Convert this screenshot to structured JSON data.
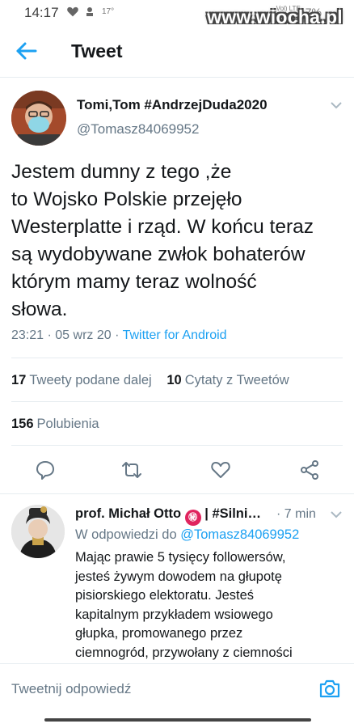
{
  "status_bar": {
    "time": "14:17",
    "temp": "17°",
    "net_top": "Vol) LTE",
    "net_bottom": "LTE1",
    "battery": "7%"
  },
  "watermark": "www.wiocha.pl",
  "header": {
    "back_icon": "arrow-left-icon",
    "title": "Tweet"
  },
  "tweet": {
    "author_name": "Tomi,Tom #AndrzejDuda2020",
    "author_handle": "@Tomasz84069952",
    "text": "Jestem dumny z tego ,że\nto Wojsko Polskie przejęło\nWesterplatte i rząd. W końcu teraz\nsą wydobywane zwłok bohaterów\nktórym mamy teraz wolność\nsłowa.",
    "time": "23:21",
    "date": "05 wrz 20",
    "separator": "·",
    "source": "Twitter for Android",
    "retweets_count": "17",
    "retweets_label": "Tweety podane dalej",
    "quotes_count": "10",
    "quotes_label": "Cytaty z Tweetów",
    "likes_count": "156",
    "likes_label": "Polubienia"
  },
  "actions": {
    "reply_icon": "comment-icon",
    "retweet_icon": "retweet-icon",
    "like_icon": "heart-icon",
    "share_icon": "share-icon"
  },
  "reply": {
    "author_name": "prof. Michał Otto",
    "badge": "㊙",
    "name_suffix": " | #Silni…",
    "time": "· 7 min",
    "reply_to_label": "W odpowiedzi do",
    "reply_to_handle": "@Tomasz84069952",
    "text": "Mając prawie 5 tysięcy followersów,\njesteś żywym dowodem na głupotę\npisiorskiego elektoratu. Jesteś\nkapitalnym przykładem wsiowego\ngłupka, promowanego przez\nciemnogród, przywołany z ciemności"
  },
  "compose": {
    "placeholder": "Tweetnij odpowiedź",
    "camera_icon": "camera-icon"
  },
  "colors": {
    "accent": "#1da1f2",
    "text": "#14171a",
    "muted": "#657786",
    "divider": "#e6ecf0"
  }
}
